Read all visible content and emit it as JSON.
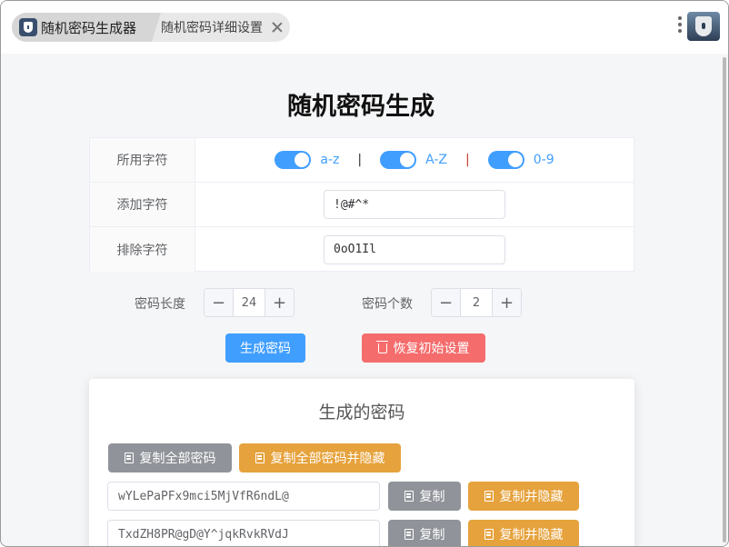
{
  "tabs": [
    {
      "label": "随机密码生成器"
    },
    {
      "label": "随机密码详细设置"
    }
  ],
  "page_title": "随机密码生成",
  "settings": {
    "charset": {
      "label": "所用字符",
      "options": [
        {
          "label": "a-z",
          "enabled": true
        },
        {
          "label": "A-Z",
          "enabled": true
        },
        {
          "label": "0-9",
          "enabled": true
        }
      ],
      "separator": "|"
    },
    "add_chars": {
      "label": "添加字符",
      "value": "!@#^*"
    },
    "exclude_chars": {
      "label": "排除字符",
      "value": "0oO1Il"
    }
  },
  "length": {
    "label": "密码长度",
    "value": "24",
    "minus": "−",
    "plus": "+"
  },
  "count": {
    "label": "密码个数",
    "value": "2",
    "minus": "−",
    "plus": "+"
  },
  "actions": {
    "generate": "生成密码",
    "reset": "恢复初始设置"
  },
  "results": {
    "title": "生成的密码",
    "copy_all": "复制全部密码",
    "copy_all_hide": "复制全部密码并隐藏",
    "copy": "复制",
    "copy_hide": "复制并隐藏",
    "passwords": [
      "wYLePaPFx9mci5MjVfR6ndL@",
      "TxdZH8PR@gD@Y^jqkRvkRVdJ"
    ]
  },
  "colors": {
    "primary": "#409eff",
    "danger": "#f56c6c",
    "info": "#909399",
    "warning": "#e6a23c",
    "separator_1": "#303133",
    "separator_2": "#c0392b"
  }
}
